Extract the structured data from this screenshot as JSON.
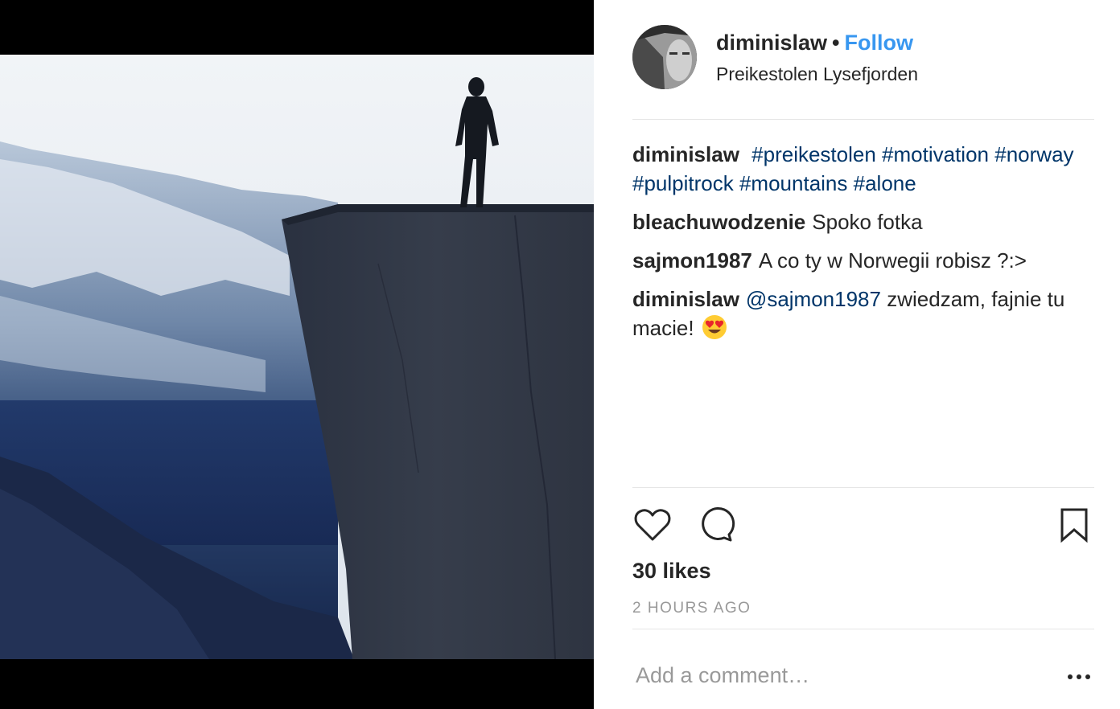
{
  "post": {
    "username": "diminislaw",
    "separator": "•",
    "follow_label": "Follow",
    "location": "Preikestolen Lysefjorden"
  },
  "comments": [
    {
      "user": "diminislaw",
      "parts": [
        "#preikestolen",
        "#motivation",
        "#norway",
        "#pulpitrock",
        "#mountains",
        "#alone"
      ]
    },
    {
      "user": "bleachuwodzenie",
      "text": "Spoko fotka"
    },
    {
      "user": "sajmon1987",
      "text": "A co ty w Norwegii robisz ?:>"
    },
    {
      "user": "diminislaw",
      "mention": "@sajmon1987",
      "text": "zwiedzam, fajnie tu macie!"
    }
  ],
  "actions": {
    "like_icon": "heart-icon",
    "comment_icon": "speech-bubble-icon",
    "save_icon": "bookmark-icon"
  },
  "likes": "30 likes",
  "timestamp": "2 HOURS AGO",
  "add_comment": {
    "placeholder": "Add a comment…",
    "value": ""
  },
  "more_icon": "ellipsis-icon",
  "colors": {
    "link": "#3897f0",
    "tag": "#003569",
    "muted": "#999999",
    "text": "#262626"
  }
}
